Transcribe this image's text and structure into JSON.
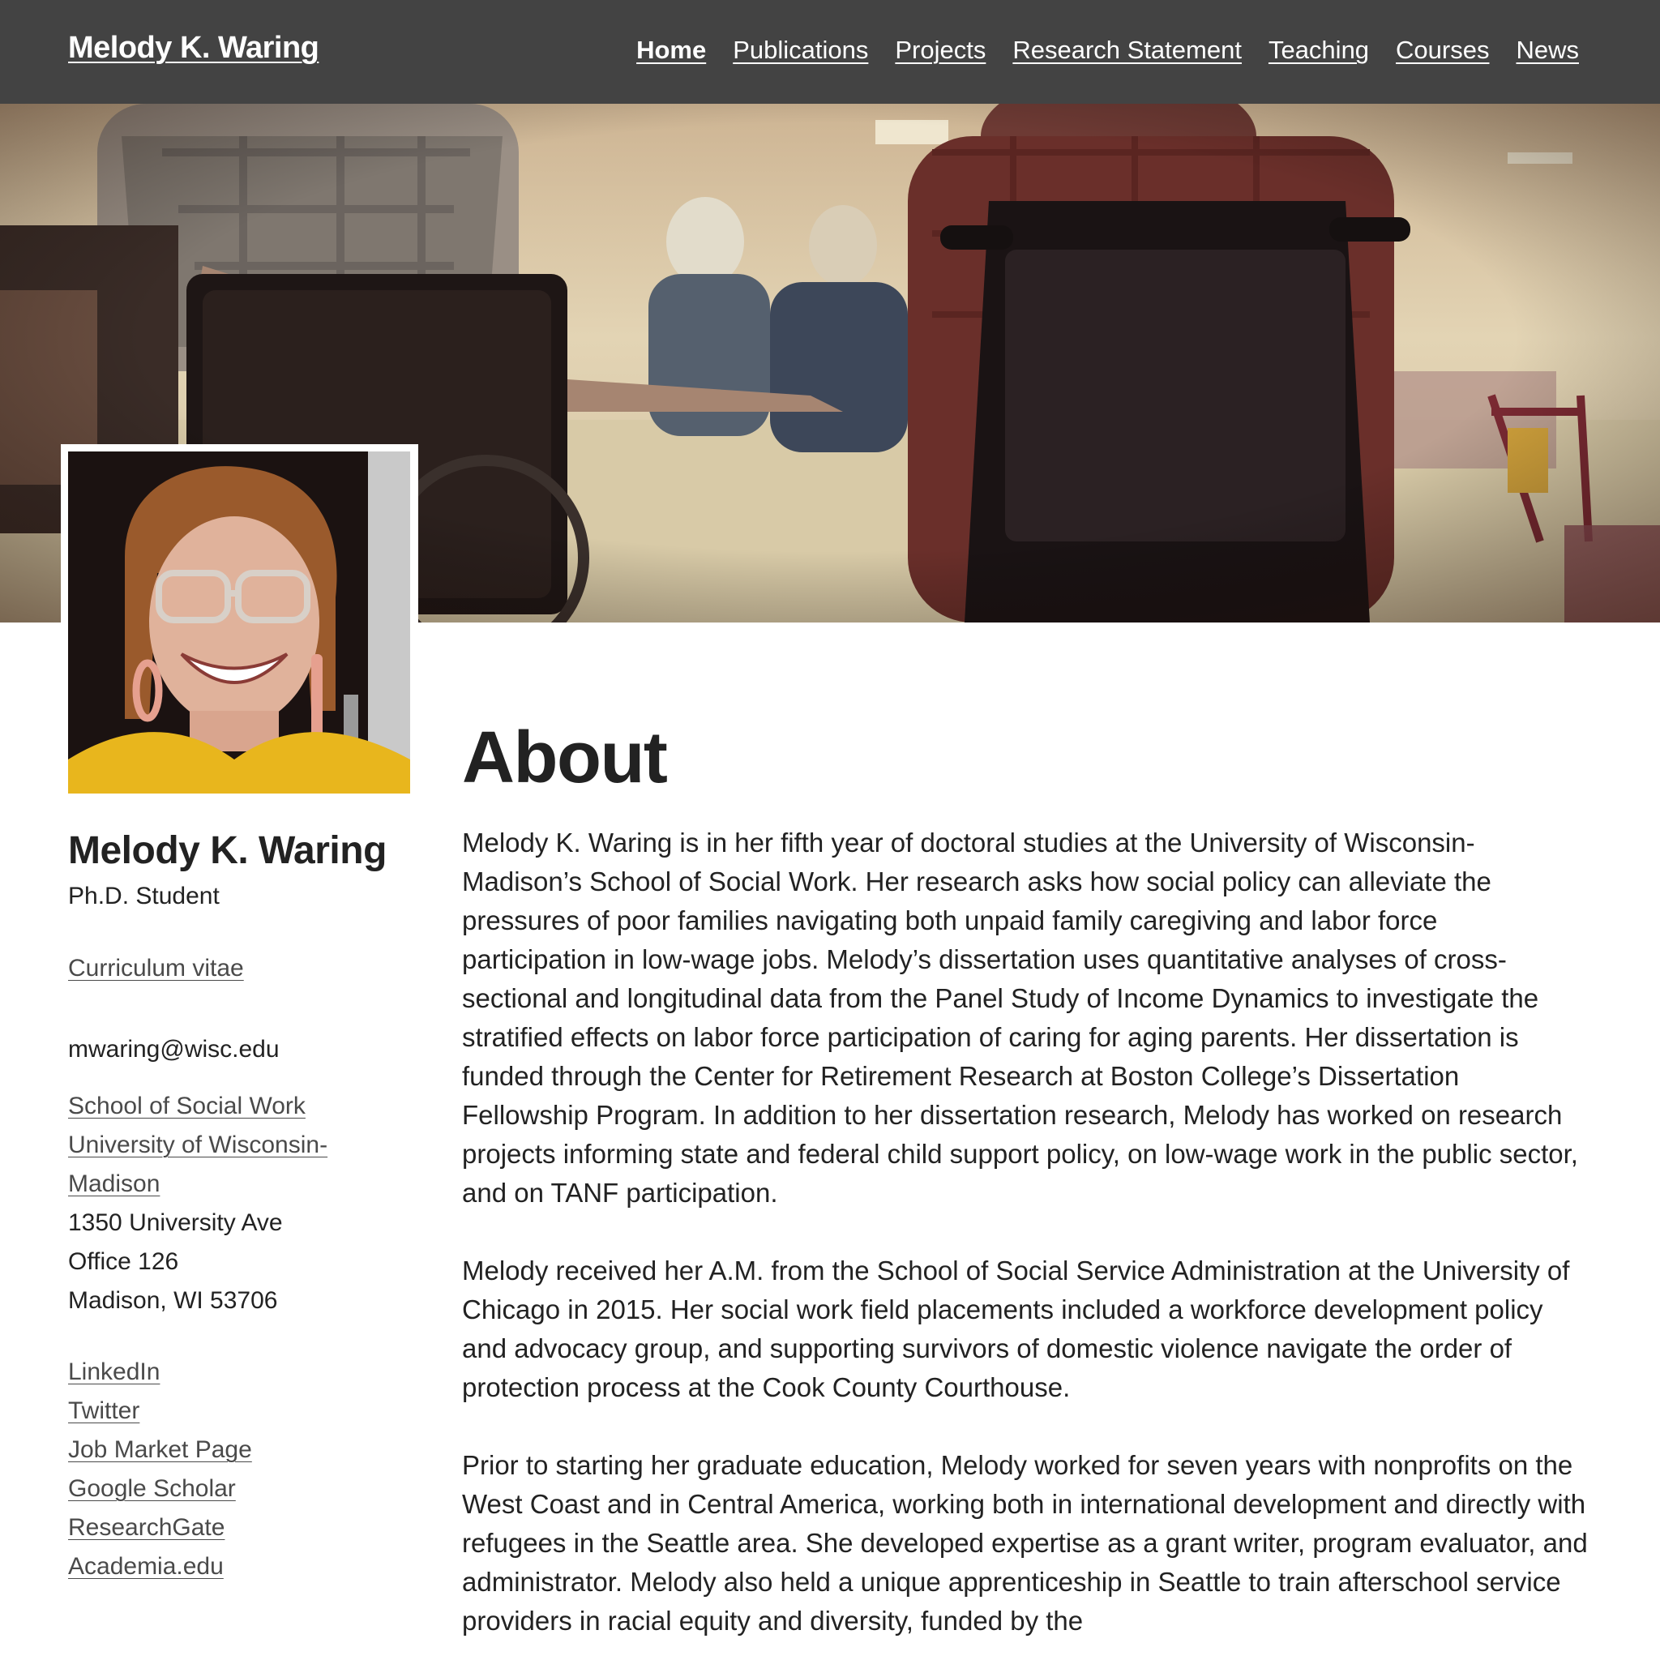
{
  "site": {
    "title": "Melody K. Waring"
  },
  "nav": {
    "items": [
      {
        "label": "Home",
        "active": true
      },
      {
        "label": "Publications",
        "active": false
      },
      {
        "label": "Projects",
        "active": false
      },
      {
        "label": "Research Statement",
        "active": false
      },
      {
        "label": "Teaching",
        "active": false
      },
      {
        "label": "Courses",
        "active": false
      },
      {
        "label": "News",
        "active": false
      }
    ]
  },
  "colors": {
    "navbar": "#434343",
    "link": "#4a4a4a",
    "text": "#222222"
  },
  "sidebar": {
    "name": "Melody K. Waring",
    "role": "Ph.D. Student",
    "cv": "Curriculum vitae",
    "email": "mwaring@wisc.edu",
    "school": "School of Social Work",
    "university_line1": "University of Wisconsin-",
    "university_line2": "Madison",
    "address_line1": "1350 University Ave",
    "address_line2": "Office 126",
    "address_line3": "Madison, WI 53706",
    "links": [
      "LinkedIn",
      "Twitter",
      "Job Market Page",
      "Google Scholar",
      "ResearchGate",
      "Academia.edu"
    ]
  },
  "main": {
    "heading": "About",
    "paragraph1": "Melody K. Waring is in her fifth year of doctoral studies at the University of Wisconsin-Madison’s School of Social Work. Her research asks how social policy can alleviate the pressures of poor families navigating both unpaid family caregiving and labor force participation in low-wage jobs. Melody’s dissertation uses quantitative analyses of cross-sectional and longitudinal data from the Panel Study of Income Dynamics to investigate the stratified effects on labor force participation of caring for aging parents. Her dissertation is funded through the Center for Retirement Research at Boston College’s Dissertation Fellowship Program. In addition to her dissertation research, Melody has worked on research projects informing state and federal child support policy, on low-wage work in the public sector, and on TANF participation.",
    "paragraph2": "Melody received her A.M. from the School of Social Service Administration at the University of Chicago in 2015. Her social work field placements included a workforce development policy and advocacy group, and supporting survivors of domestic violence navigate the order of protection process at the Cook County Courthouse.",
    "paragraph3": "Prior to starting her graduate education, Melody worked for seven years with nonprofits on the West Coast and in Central America, working both in international development and directly with refugees in the Seattle area. She developed expertise as a grant writer, program evaluator, and administrator. Melody also held a unique apprenticeship in Seattle to train afterschool service providers in racial equity and diversity, funded by the"
  }
}
